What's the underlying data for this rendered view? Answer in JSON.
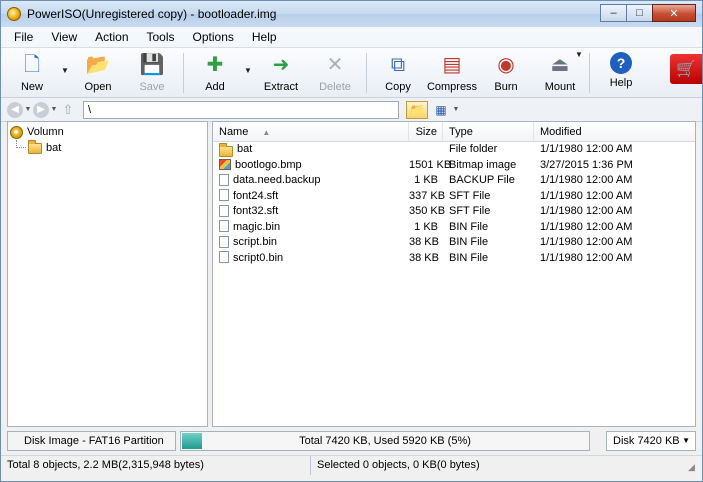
{
  "window": {
    "title": "PowerISO(Unregistered copy) - bootloader.img",
    "minimize": "–",
    "maximize": "□",
    "close": "✕"
  },
  "menu": [
    "File",
    "View",
    "Action",
    "Tools",
    "Options",
    "Help"
  ],
  "toolbar": {
    "new": "New",
    "open": "Open",
    "save": "Save",
    "add": "Add",
    "extract": "Extract",
    "delete": "Delete",
    "copy": "Copy",
    "compress": "Compress",
    "burn": "Burn",
    "mount": "Mount",
    "help": "Help"
  },
  "address": {
    "path": "\\"
  },
  "tree": {
    "root": "Volumn",
    "children": [
      "bat"
    ]
  },
  "list": {
    "columns": {
      "name": "Name",
      "size": "Size",
      "type": "Type",
      "modified": "Modified"
    },
    "rows": [
      {
        "name": "bat",
        "size": "",
        "type": "File folder",
        "modified": "1/1/1980 12:00 AM",
        "icon": "folder-icon"
      },
      {
        "name": "bootlogo.bmp",
        "size": "1501 KB",
        "type": "Bitmap image",
        "modified": "3/27/2015 1:36 PM",
        "icon": "bitmap-icon"
      },
      {
        "name": "data.need.backup",
        "size": "1 KB",
        "type": "BACKUP File",
        "modified": "1/1/1980 12:00 AM",
        "icon": "file-icon"
      },
      {
        "name": "font24.sft",
        "size": "337 KB",
        "type": "SFT File",
        "modified": "1/1/1980 12:00 AM",
        "icon": "file-icon"
      },
      {
        "name": "font32.sft",
        "size": "350 KB",
        "type": "SFT File",
        "modified": "1/1/1980 12:00 AM",
        "icon": "file-icon"
      },
      {
        "name": "magic.bin",
        "size": "1 KB",
        "type": "BIN File",
        "modified": "1/1/1980 12:00 AM",
        "icon": "file-icon"
      },
      {
        "name": "script.bin",
        "size": "38 KB",
        "type": "BIN File",
        "modified": "1/1/1980 12:00 AM",
        "icon": "file-icon"
      },
      {
        "name": "script0.bin",
        "size": "38 KB",
        "type": "BIN File",
        "modified": "1/1/1980 12:00 AM",
        "icon": "file-icon"
      }
    ]
  },
  "disk": {
    "image_type": "Disk Image - FAT16 Partition",
    "usage_text": "Total 7420 KB, Used 5920 KB (5%)",
    "usage_fraction": 0.05,
    "capacity": "Disk 7420 KB"
  },
  "status": {
    "left": "Total 8 objects, 2.2 MB(2,315,948 bytes)",
    "right": "Selected 0 objects, 0 KB(0 bytes)"
  },
  "colors": {
    "accent": "#1f9b8e",
    "title_bar": "#c5d9ef",
    "close_button": "#c74f33"
  }
}
